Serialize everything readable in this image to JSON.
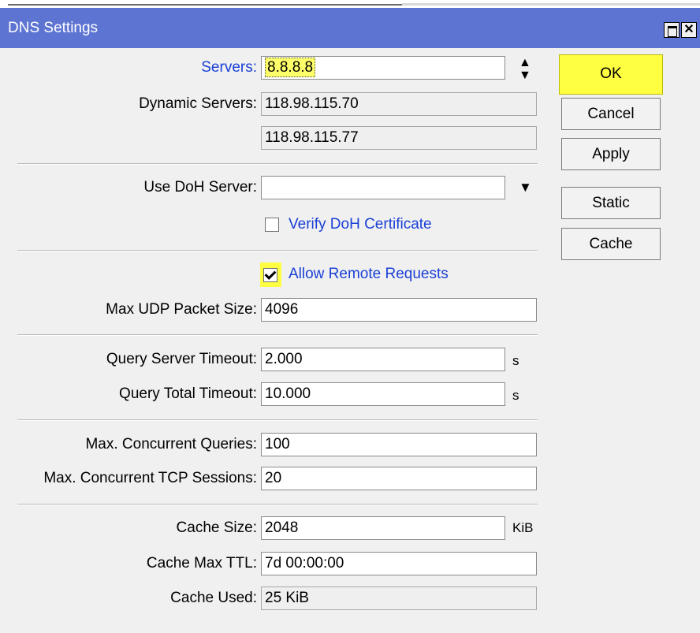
{
  "window": {
    "title": "DNS Settings"
  },
  "fields": {
    "servers": {
      "label": "Servers:",
      "value": "8.8.8.8"
    },
    "dynamic_servers": {
      "label": "Dynamic Servers:",
      "values": [
        "118.98.115.70",
        "118.98.115.77"
      ]
    },
    "use_doh_server": {
      "label": "Use DoH Server:",
      "value": ""
    },
    "verify_doh_certificate": {
      "label": "Verify DoH Certificate",
      "checked": false
    },
    "allow_remote_requests": {
      "label": "Allow Remote Requests",
      "checked": true
    },
    "max_udp_packet_size": {
      "label": "Max UDP Packet Size:",
      "value": "4096"
    },
    "query_server_timeout": {
      "label": "Query Server Timeout:",
      "value": "2.000",
      "unit": "s"
    },
    "query_total_timeout": {
      "label": "Query Total Timeout:",
      "value": "10.000",
      "unit": "s"
    },
    "max_concurrent_queries": {
      "label": "Max. Concurrent Queries:",
      "value": "100"
    },
    "max_concurrent_tcp_sessions": {
      "label": "Max. Concurrent TCP Sessions:",
      "value": "20"
    },
    "cache_size": {
      "label": "Cache Size:",
      "value": "2048",
      "unit": "KiB"
    },
    "cache_max_ttl": {
      "label": "Cache Max TTL:",
      "value": "7d 00:00:00"
    },
    "cache_used": {
      "label": "Cache Used:",
      "value": "25 KiB"
    }
  },
  "buttons": {
    "ok": "OK",
    "cancel": "Cancel",
    "apply": "Apply",
    "static": "Static",
    "cache": "Cache"
  },
  "icons": {
    "updown": "up-down-arrow-icon",
    "dropdown": "dropdown-arrow-icon",
    "maximize": "maximize-icon",
    "close": "close-icon"
  },
  "colors": {
    "titlebar": "#5e74d2",
    "highlight": "#ffff42",
    "link_label": "#1a3fd6"
  }
}
